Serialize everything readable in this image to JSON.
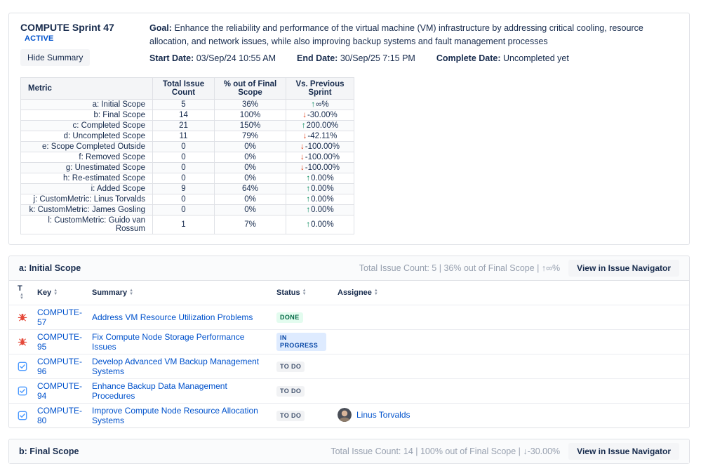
{
  "summary_panel": {
    "title": "COMPUTE Sprint 47",
    "status_badge": "ACTIVE",
    "hide_summary_label": "Hide Summary",
    "goal_label": "Goal:",
    "goal_text": "Enhance the reliability and performance of the virtual machine (VM) infrastructure by addressing critical cooling, resource allocation, and network issues, while also improving backup systems and fault management processes",
    "start_date_label": "Start Date:",
    "start_date_value": "03/Sep/24 10:55 AM",
    "end_date_label": "End Date:",
    "end_date_value": "30/Sep/25 7:15 PM",
    "complete_date_label": "Complete Date:",
    "complete_date_value": "Uncompleted yet",
    "metrics_table": {
      "headers": [
        "Metric",
        "Total Issue Count",
        "% out of Final Scope",
        "Vs. Previous Sprint"
      ],
      "rows": [
        {
          "metric": "a: Initial Scope",
          "count": "5",
          "pct": "36%",
          "trend_dir": "up",
          "trend_value": "∞%"
        },
        {
          "metric": "b: Final Scope",
          "count": "14",
          "pct": "100%",
          "trend_dir": "down",
          "trend_value": "-30.00%"
        },
        {
          "metric": "c: Completed Scope",
          "count": "21",
          "pct": "150%",
          "trend_dir": "up",
          "trend_value": "200.00%"
        },
        {
          "metric": "d: Uncompleted Scope",
          "count": "11",
          "pct": "79%",
          "trend_dir": "down",
          "trend_value": "-42.11%"
        },
        {
          "metric": "e: Scope Completed Outside",
          "count": "0",
          "pct": "0%",
          "trend_dir": "down",
          "trend_value": "-100.00%"
        },
        {
          "metric": "f: Removed Scope",
          "count": "0",
          "pct": "0%",
          "trend_dir": "down",
          "trend_value": "-100.00%"
        },
        {
          "metric": "g: Unestimated Scope",
          "count": "0",
          "pct": "0%",
          "trend_dir": "down",
          "trend_value": "-100.00%"
        },
        {
          "metric": "h: Re-estimated Scope",
          "count": "0",
          "pct": "0%",
          "trend_dir": "up",
          "trend_value": "0.00%"
        },
        {
          "metric": "i: Added Scope",
          "count": "9",
          "pct": "64%",
          "trend_dir": "up",
          "trend_value": "0.00%"
        },
        {
          "metric": "j: CustomMetric: Linus Torvalds",
          "count": "0",
          "pct": "0%",
          "trend_dir": "up",
          "trend_value": "0.00%"
        },
        {
          "metric": "k: CustomMetric: James Gosling",
          "count": "0",
          "pct": "0%",
          "trend_dir": "up",
          "trend_value": "0.00%"
        },
        {
          "metric": "l: CustomMetric: Guido van Rossum",
          "count": "1",
          "pct": "7%",
          "trend_dir": "up",
          "trend_value": "0.00%"
        }
      ]
    }
  },
  "issue_columns": [
    {
      "label": "T",
      "sort_icon": "sort-icon"
    },
    {
      "label": "Key",
      "sort_icon": "sort-icon"
    },
    {
      "label": "Summary",
      "sort_icon": "sort-icon"
    },
    {
      "label": "Status",
      "sort_icon": "sort-icon"
    },
    {
      "label": "Assignee",
      "sort_icon": "sort-icon"
    }
  ],
  "sections": [
    {
      "title": "a: Initial Scope",
      "stats": "Total Issue Count: 5 | 36% out of Final Scope | ↑∞%",
      "view_button_label": "View in Issue Navigator",
      "issues": [
        {
          "type_icon": "bug-icon",
          "key": "COMPUTE-57",
          "summary": "Address VM Resource Utilization Problems",
          "status": "DONE",
          "status_kind": "done",
          "assignee": ""
        },
        {
          "type_icon": "bug-icon",
          "key": "COMPUTE-95",
          "summary": "Fix Compute Node Storage Performance Issues",
          "status": "IN PROGRESS",
          "status_kind": "inprogress",
          "assignee": ""
        },
        {
          "type_icon": "task-icon",
          "key": "COMPUTE-96",
          "summary": "Develop Advanced VM Backup Management Systems",
          "status": "TO DO",
          "status_kind": "todo",
          "assignee": ""
        },
        {
          "type_icon": "task-icon",
          "key": "COMPUTE-94",
          "summary": "Enhance Backup Data Management Procedures",
          "status": "TO DO",
          "status_kind": "todo",
          "assignee": ""
        },
        {
          "type_icon": "task-icon",
          "key": "COMPUTE-80",
          "summary": "Improve Compute Node Resource Allocation Systems",
          "status": "TO DO",
          "status_kind": "todo",
          "assignee": "Linus Torvalds"
        }
      ]
    },
    {
      "title": "b: Final Scope",
      "stats": "Total Issue Count: 14 | 100% out of Final Scope | ↓-30.00%",
      "view_button_label": "View in Issue Navigator"
    }
  ],
  "colors": {
    "accent_blue": "#0052CC",
    "text_navy": "#172B4D",
    "muted_gray": "#97A0AF",
    "trend_up_green": "#00875A",
    "trend_down_red": "#DE350B",
    "badge_done_bg": "#E3FCEF",
    "badge_done_text": "#006644",
    "badge_inprogress_bg": "#DEEBFF",
    "badge_inprogress_text": "#0747A6",
    "badge_todo_bg": "#F1F2F4",
    "badge_todo_text": "#42526E"
  }
}
